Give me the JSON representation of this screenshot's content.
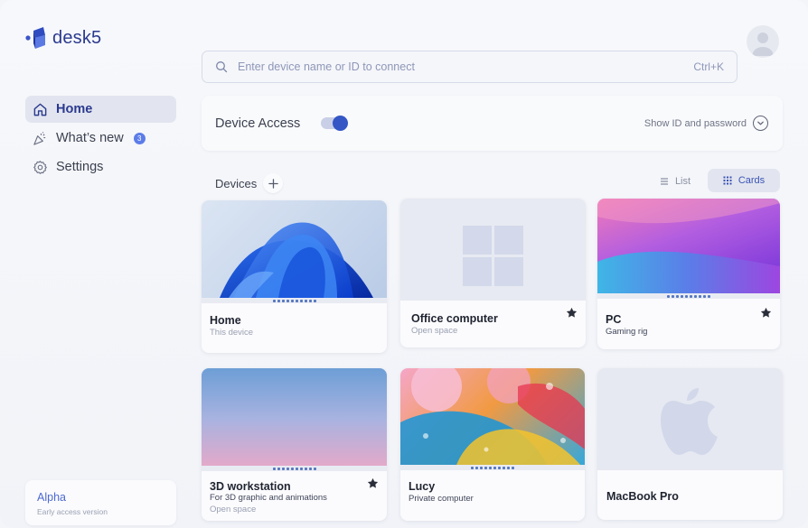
{
  "app": {
    "name": "desk5"
  },
  "sidebar": {
    "items": [
      {
        "label": "Home",
        "icon": "home-icon",
        "active": true
      },
      {
        "label": "What’s new",
        "icon": "party-popper-icon",
        "badge": "3"
      },
      {
        "label": "Settings",
        "icon": "gear-icon"
      }
    ],
    "footer": {
      "title": "Alpha",
      "subtitle": "Early access version"
    }
  },
  "search": {
    "placeholder": "Enter device name or ID to connect",
    "shortcut": "Ctrl+K"
  },
  "device_access": {
    "title": "Device Access",
    "enabled": true,
    "toggle_label": "Show ID and password"
  },
  "devices": {
    "title": "Devices",
    "views": {
      "list": "List",
      "cards": "Cards",
      "selected": "Cards"
    },
    "cards": [
      {
        "name": "Home",
        "description": "This device",
        "wallpaper": "windows-bloom",
        "starred": false
      },
      {
        "name": "Office computer",
        "description": "Open space",
        "wallpaper": "windows-logo",
        "starred": true
      },
      {
        "name": "PC",
        "description": "Gaming rig",
        "wallpaper": "purple-gradient",
        "starred": true
      },
      {
        "name": "3D workstation",
        "description": "For 3D graphic and animations",
        "description2": "Open space",
        "wallpaper": "blue-pink-gradient",
        "starred": true
      },
      {
        "name": "Lucy",
        "description": "Private computer",
        "wallpaper": "colorful-bubbles",
        "starred": false
      },
      {
        "name": "MacBook Pro",
        "description": "",
        "wallpaper": "apple-logo",
        "starred": false
      }
    ]
  },
  "colors": {
    "accent": "#3457c5",
    "brand": "#2b3a8f",
    "badge": "#5c7de8"
  }
}
